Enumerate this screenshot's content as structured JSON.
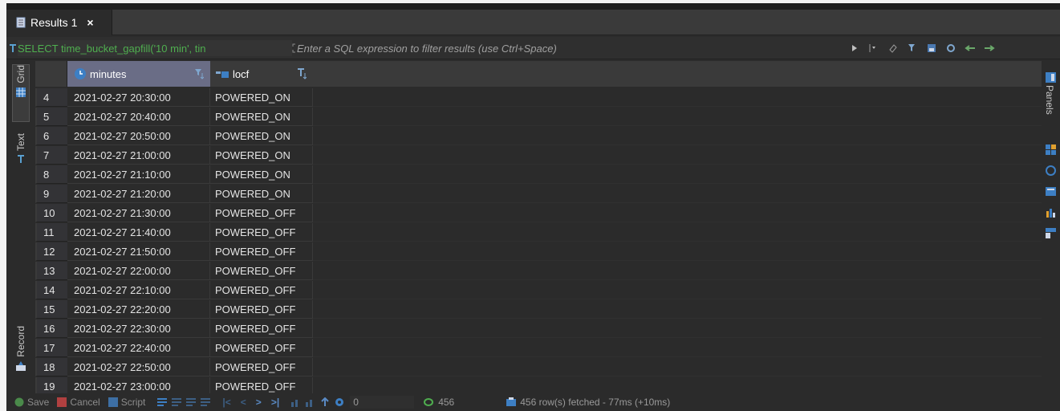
{
  "tab": {
    "label": "Results 1",
    "close": "×",
    "icon": "table-icon"
  },
  "filter": {
    "sql_label": "SELECT time_bucket_gapfill('10 min', tin",
    "placeholder": "Enter a SQL expression to filter results (use Ctrl+Space)"
  },
  "left_tabs": {
    "grid": "Grid",
    "text": "Text",
    "record": "Record"
  },
  "right_panel": {
    "label": "Panels"
  },
  "columns": [
    {
      "name": "minutes",
      "icon": "clock-icon"
    },
    {
      "name": "locf",
      "icon": "column-icon"
    }
  ],
  "rows": [
    {
      "n": "4",
      "minutes": "2021-02-27 20:30:00",
      "locf": "POWERED_ON"
    },
    {
      "n": "5",
      "minutes": "2021-02-27 20:40:00",
      "locf": "POWERED_ON"
    },
    {
      "n": "6",
      "minutes": "2021-02-27 20:50:00",
      "locf": "POWERED_ON"
    },
    {
      "n": "7",
      "minutes": "2021-02-27 21:00:00",
      "locf": "POWERED_ON"
    },
    {
      "n": "8",
      "minutes": "2021-02-27 21:10:00",
      "locf": "POWERED_ON"
    },
    {
      "n": "9",
      "minutes": "2021-02-27 21:20:00",
      "locf": "POWERED_ON"
    },
    {
      "n": "10",
      "minutes": "2021-02-27 21:30:00",
      "locf": "POWERED_OFF"
    },
    {
      "n": "11",
      "minutes": "2021-02-27 21:40:00",
      "locf": "POWERED_OFF"
    },
    {
      "n": "12",
      "minutes": "2021-02-27 21:50:00",
      "locf": "POWERED_OFF"
    },
    {
      "n": "13",
      "minutes": "2021-02-27 22:00:00",
      "locf": "POWERED_OFF"
    },
    {
      "n": "14",
      "minutes": "2021-02-27 22:10:00",
      "locf": "POWERED_OFF"
    },
    {
      "n": "15",
      "minutes": "2021-02-27 22:20:00",
      "locf": "POWERED_OFF"
    },
    {
      "n": "16",
      "minutes": "2021-02-27 22:30:00",
      "locf": "POWERED_OFF"
    },
    {
      "n": "17",
      "minutes": "2021-02-27 22:40:00",
      "locf": "POWERED_OFF"
    },
    {
      "n": "18",
      "minutes": "2021-02-27 22:50:00",
      "locf": "POWERED_OFF"
    },
    {
      "n": "19",
      "minutes": "2021-02-27 23:00:00",
      "locf": "POWERED_OFF"
    }
  ],
  "status": {
    "save": "Save",
    "cancel": "Cancel",
    "script": "Script",
    "fetch_size": "0",
    "total": "456",
    "fetched": "456 row(s) fetched - 77ms (+10ms)"
  },
  "colors": {
    "accent": "#6a6d86",
    "sql": "#4fae4f",
    "bg": "#2b2b2b"
  }
}
